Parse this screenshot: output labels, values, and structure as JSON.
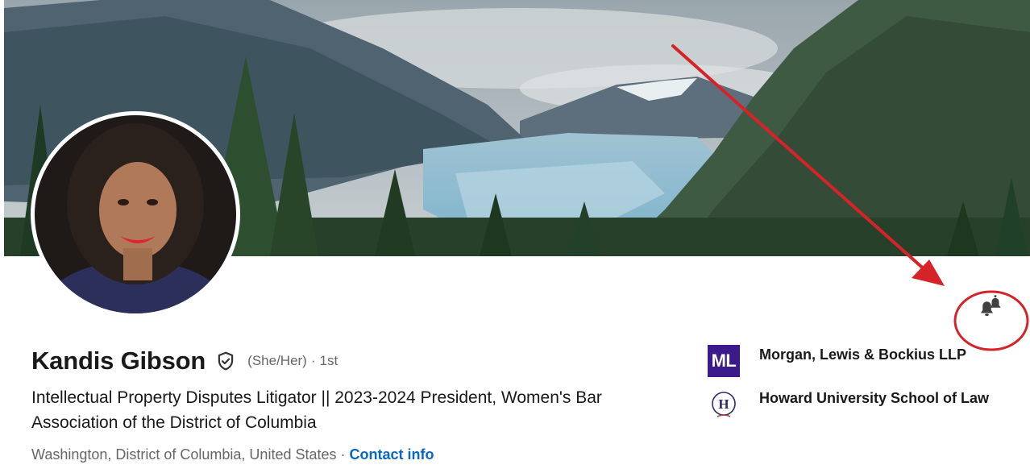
{
  "profile": {
    "name": "Kandis Gibson",
    "pronouns": "(She/Her)",
    "separator": "·",
    "connection_degree": "1st",
    "headline": "Intellectual Property Disputes Litigator || 2023-2024 President, Women's Bar Association of the District of Columbia",
    "location": "Washington, District of Columbia, United States",
    "location_separator": " · ",
    "contact_info_label": "Contact info"
  },
  "orgs": [
    {
      "logo_text": "ML",
      "name": "Morgan, Lewis & Bockius LLP",
      "logo_color": "#3b1b8c"
    },
    {
      "logo_text": "H",
      "name": "Howard University School of Law",
      "logo_color": "#2c2c6c"
    }
  ],
  "icons": {
    "verified": "shield-check-icon",
    "notification": "bell-icon"
  },
  "colors": {
    "link": "#0a66c2",
    "annotation": "#d6232a",
    "text_primary": "#000000e6",
    "text_secondary": "#666666"
  }
}
